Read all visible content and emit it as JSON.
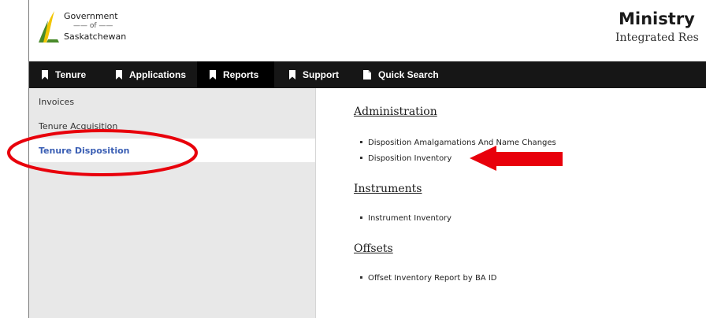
{
  "header": {
    "logo_line1": "Government",
    "logo_line2": "of",
    "logo_line3": "Saskatchewan",
    "ministry": "Ministry",
    "subtitle": "Integrated Res"
  },
  "nav": {
    "items": [
      {
        "label": "Tenure",
        "icon": "bookmark-icon"
      },
      {
        "label": "Applications",
        "icon": "bookmark-icon"
      },
      {
        "label": "Reports",
        "icon": "bookmark-icon"
      },
      {
        "label": "Support",
        "icon": "bookmark-icon"
      },
      {
        "label": "Quick Search",
        "icon": "document-icon"
      }
    ],
    "active": "Reports"
  },
  "sidebar": {
    "items": [
      {
        "label": "Invoices"
      },
      {
        "label": "Tenure Acquisition"
      },
      {
        "label": "Tenure Disposition"
      }
    ],
    "active": "Tenure Disposition"
  },
  "main": {
    "sections": [
      {
        "title": "Administration",
        "links": [
          "Disposition Amalgamations And Name Changes",
          "Disposition Inventory"
        ]
      },
      {
        "title": "Instruments",
        "links": [
          "Instrument Inventory"
        ]
      },
      {
        "title": "Offsets",
        "links": [
          "Offset Inventory Report by BA ID"
        ]
      }
    ]
  },
  "colors": {
    "nav_bg": "#161616",
    "sidebar_bg": "#e8e8e8",
    "active_link": "#3b5fb4",
    "annotation_red": "#e8000b",
    "logo_green": "#4a8a2a",
    "logo_yellow": "#f2c500"
  }
}
